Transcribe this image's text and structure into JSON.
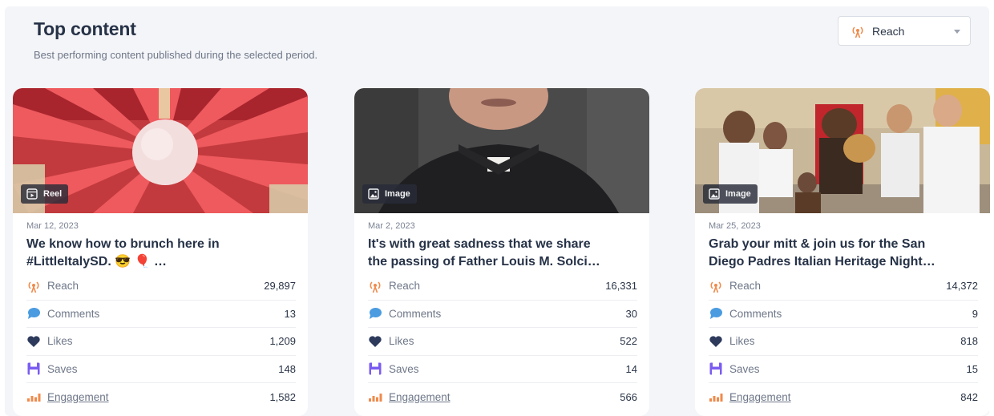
{
  "header": {
    "title": "Top content",
    "subtitle": "Best performing content published during the selected period."
  },
  "metric_select": {
    "selected": "Reach",
    "icon": "reach-antenna-icon"
  },
  "colors": {
    "reach": "#f08a4b",
    "comments": "#4a9be0",
    "likes": "#2d3a5c",
    "saves": "#7b5cf0",
    "engagement": "#f08a4b"
  },
  "cards": [
    {
      "type": "Reel",
      "type_icon": "reel-icon",
      "date": "Mar 12, 2023",
      "caption_line1": "We know how to brunch here in",
      "caption_line2": "#LittleItalySD. 😎 🎈 …",
      "metrics": {
        "reach": {
          "label": "Reach",
          "value": "29,897"
        },
        "comments": {
          "label": "Comments",
          "value": "13"
        },
        "likes": {
          "label": "Likes",
          "value": "1,209"
        },
        "saves": {
          "label": "Saves",
          "value": "148"
        },
        "engagement": {
          "label": "Engagement",
          "value": "1,582"
        }
      }
    },
    {
      "type": "Image",
      "type_icon": "image-icon",
      "date": "Mar 2, 2023",
      "caption_line1": "It's with great sadness that we share",
      "caption_line2": "the passing of Father Louis M. Solci…",
      "metrics": {
        "reach": {
          "label": "Reach",
          "value": "16,331"
        },
        "comments": {
          "label": "Comments",
          "value": "30"
        },
        "likes": {
          "label": "Likes",
          "value": "522"
        },
        "saves": {
          "label": "Saves",
          "value": "14"
        },
        "engagement": {
          "label": "Engagement",
          "value": "566"
        }
      }
    },
    {
      "type": "Image",
      "type_icon": "image-icon",
      "date": "Mar 25, 2023",
      "caption_line1": "Grab your mitt & join us for the San",
      "caption_line2": "Diego Padres Italian Heritage Night…",
      "metrics": {
        "reach": {
          "label": "Reach",
          "value": "14,372"
        },
        "comments": {
          "label": "Comments",
          "value": "9"
        },
        "likes": {
          "label": "Likes",
          "value": "818"
        },
        "saves": {
          "label": "Saves",
          "value": "15"
        },
        "engagement": {
          "label": "Engagement",
          "value": "842"
        }
      }
    }
  ]
}
